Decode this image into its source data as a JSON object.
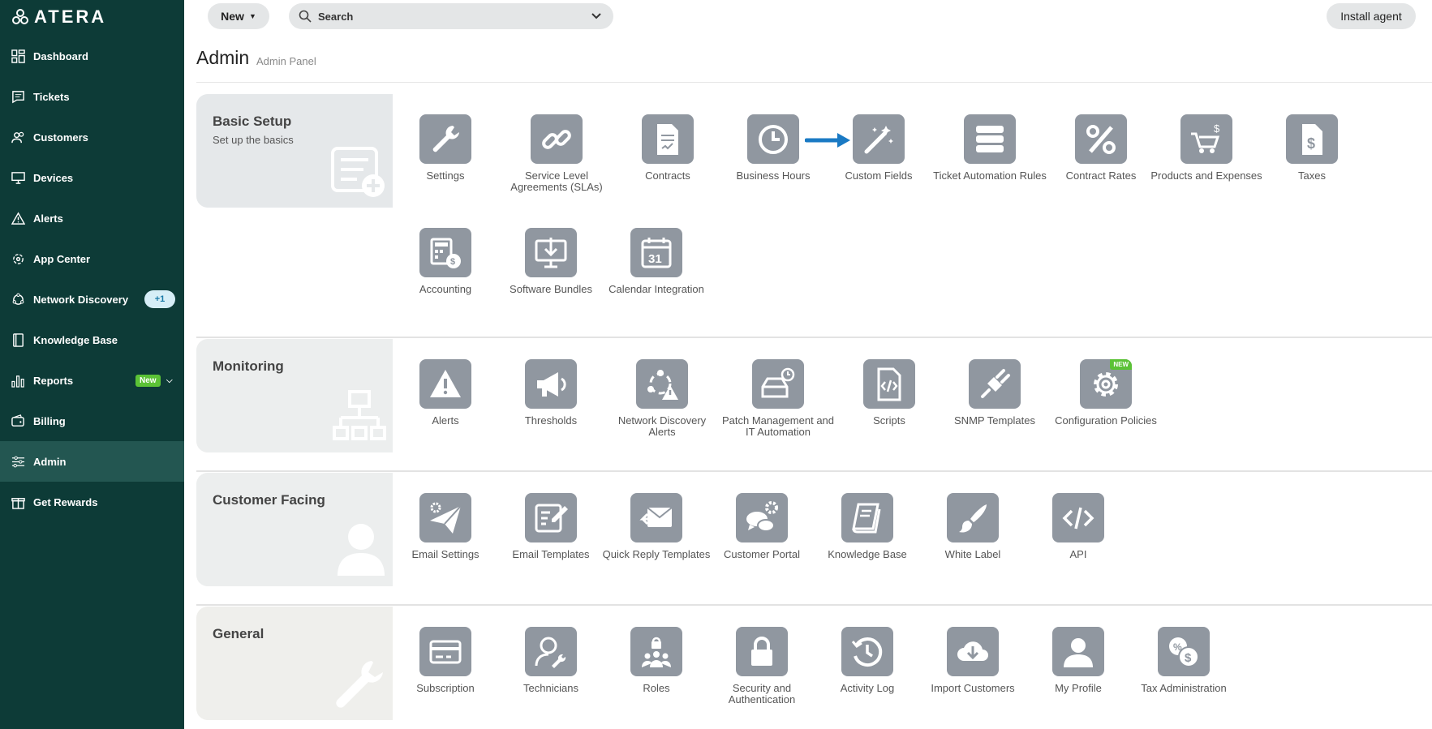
{
  "brand": {
    "name": "ATERA"
  },
  "sidebar": {
    "items": [
      {
        "label": "Dashboard",
        "icon": "dashboard-icon"
      },
      {
        "label": "Tickets",
        "icon": "tickets-icon"
      },
      {
        "label": "Customers",
        "icon": "customers-icon"
      },
      {
        "label": "Devices",
        "icon": "devices-icon"
      },
      {
        "label": "Alerts",
        "icon": "alert-triangle-icon"
      },
      {
        "label": "App Center",
        "icon": "app-center-icon"
      },
      {
        "label": "Network Discovery",
        "icon": "network-discovery-icon",
        "badge": "+1"
      },
      {
        "label": "Knowledge Base",
        "icon": "book-icon"
      },
      {
        "label": "Reports",
        "icon": "reports-icon",
        "badge": "New"
      },
      {
        "label": "Billing",
        "icon": "billing-icon"
      },
      {
        "label": "Admin",
        "icon": "admin-sliders-icon",
        "active": true
      },
      {
        "label": "Get Rewards",
        "icon": "gift-icon"
      }
    ]
  },
  "topbar": {
    "new_label": "New",
    "search_label": "Search",
    "install_label": "Install agent"
  },
  "page": {
    "title": "Admin",
    "subtitle": "Admin Panel"
  },
  "sections": {
    "basic": {
      "title": "Basic Setup",
      "subtitle": "Set up the basics",
      "tiles": [
        {
          "label": "Settings"
        },
        {
          "label": "Service Level Agreements (SLAs)"
        },
        {
          "label": "Contracts"
        },
        {
          "label": "Business Hours"
        },
        {
          "label": "Custom Fields"
        },
        {
          "label": "Ticket Automation Rules"
        },
        {
          "label": "Contract Rates"
        },
        {
          "label": "Products and Expenses"
        },
        {
          "label": "Taxes"
        },
        {
          "label": "Accounting"
        },
        {
          "label": "Software Bundles"
        },
        {
          "label": "Calendar Integration"
        }
      ]
    },
    "monitoring": {
      "title": "Monitoring",
      "tiles": [
        {
          "label": "Alerts"
        },
        {
          "label": "Thresholds"
        },
        {
          "label": "Network Discovery Alerts"
        },
        {
          "label": "Patch Management and IT Automation"
        },
        {
          "label": "Scripts"
        },
        {
          "label": "SNMP Templates"
        },
        {
          "label": "Configuration Policies",
          "tag": "NEW"
        }
      ]
    },
    "customer": {
      "title": "Customer Facing",
      "tiles": [
        {
          "label": "Email Settings"
        },
        {
          "label": "Email Templates"
        },
        {
          "label": "Quick Reply Templates"
        },
        {
          "label": "Customer Portal"
        },
        {
          "label": "Knowledge Base"
        },
        {
          "label": "White Label"
        },
        {
          "label": "API"
        }
      ]
    },
    "general": {
      "title": "General",
      "tiles": [
        {
          "label": "Subscription"
        },
        {
          "label": "Technicians"
        },
        {
          "label": "Roles"
        },
        {
          "label": "Security and Authentication"
        },
        {
          "label": "Activity Log"
        },
        {
          "label": "Import Customers"
        },
        {
          "label": "My Profile"
        },
        {
          "label": "Tax Administration"
        }
      ]
    }
  },
  "colors": {
    "sidebar": "#0d3b37",
    "sidebar_active": "#235651",
    "tile": "#9097a0",
    "arrow": "#1a7ac4",
    "new_badge": "#5bc236"
  }
}
